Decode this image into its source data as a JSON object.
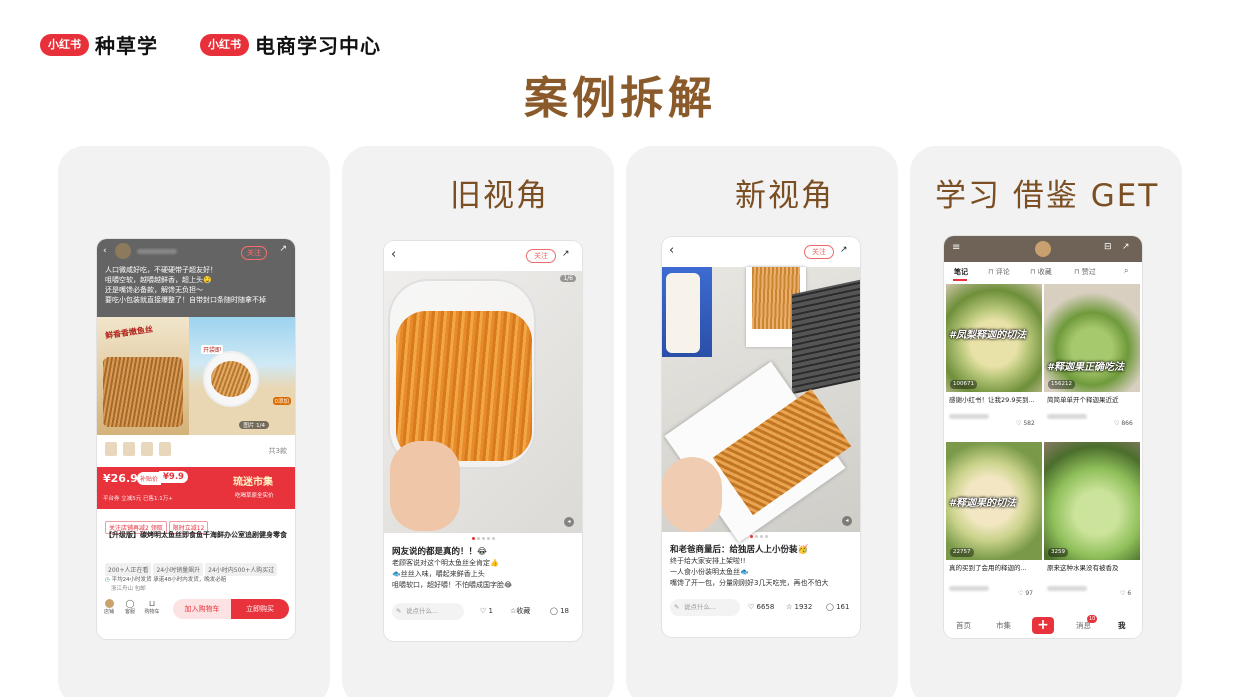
{
  "header": {
    "brand1_badge": "小红书",
    "brand1_text": "种草学",
    "brand2_badge": "小红书",
    "brand2_text": "电商学习中心"
  },
  "page_title": "案例拆解",
  "cards": {
    "old_view_title": "旧视角",
    "new_view_title": "新视角",
    "learn_title": "学习 借鉴 GET"
  },
  "phone1": {
    "follow": "关注",
    "dim_lines": [
      "人口微咸好吃，不硬硬带子超友好！",
      "咀嚼空软，越嚼越鲜香，超上头🤤",
      "还是嘴馋必备款，解馋无负担～",
      "要吃小包装就直接爆整了！自带封口条随时随拿不掉"
    ],
    "image_counter": "图片 1/4",
    "thumb_count": "共3款",
    "price": "¥26.9",
    "subsidy_label": "补贴价",
    "subsidy_price": "¥9.9",
    "price_sub": "平台券 立减5元   已售1.1万+",
    "promo_title": "琉迷市集",
    "promo_sub": "吃喝草原全实价",
    "tags": [
      "关注店铺再减2  领取",
      "限时立减12"
    ],
    "product_title": "【升级版】碳烤明太鱼丝即食鱼干海鲜办公室追剧健身零食",
    "chips": [
      "200+人正在看",
      "24小时销量飙升",
      "24小时内500+人购买过"
    ],
    "ship_info": "平均24小时发货  承诺48小时内发货，晚发必赔",
    "ship_from": "浙江舟山 包邮",
    "icons": [
      "店铺",
      "客服",
      "购物车"
    ],
    "btn_cart": "加入购物车",
    "btn_buy": "立即购买"
  },
  "phone2": {
    "follow": "关注",
    "counter": "1/6",
    "title": "网友说的都是真的！！😂",
    "lines": [
      "老顾客说对这个明太鱼丝全肯定👍",
      "🐟丝丝入味，嚼起来鲜香上头",
      "咀嚼软口，超好嚼！不怕嚼成国字脸😂"
    ],
    "comment_placeholder": "说点什么...",
    "likes": "1",
    "collect": "收藏",
    "comments": "18"
  },
  "phone3": {
    "follow": "关注",
    "title": "和老爸商量后：给独居人上小份装🥳",
    "lines": [
      "终于给大家安排上架啦!!",
      "一人食小份装明太鱼丝🐟",
      "嘴馋了开一包，分量刚刚好3几天吃完，再也不怕大"
    ],
    "comment_placeholder": "说点什么...",
    "likes": "6658",
    "collect": "1932",
    "comments": "161"
  },
  "phone4": {
    "tabs": [
      "笔记",
      "评论",
      "收藏",
      "赞过"
    ],
    "tiles": [
      {
        "overlay": "#凤梨释迦的切法",
        "views": "100671",
        "caption": "感谢小红书！让我29.9买到...",
        "likes": "582"
      },
      {
        "overlay": "#释迦果正确吃法",
        "views": "156212",
        "caption": "简简单单开个释迦果近近",
        "likes": "866"
      },
      {
        "overlay": "#释迦果的切法",
        "views": "22757",
        "caption": "真的买到了会用的释迦的...",
        "likes": "97"
      },
      {
        "overlay": "",
        "views": "3259",
        "caption": "原来这种水果没有被香及",
        "likes": "6"
      }
    ],
    "nav": [
      "首页",
      "市集",
      "消息",
      "我"
    ],
    "msg_badge": "10"
  }
}
